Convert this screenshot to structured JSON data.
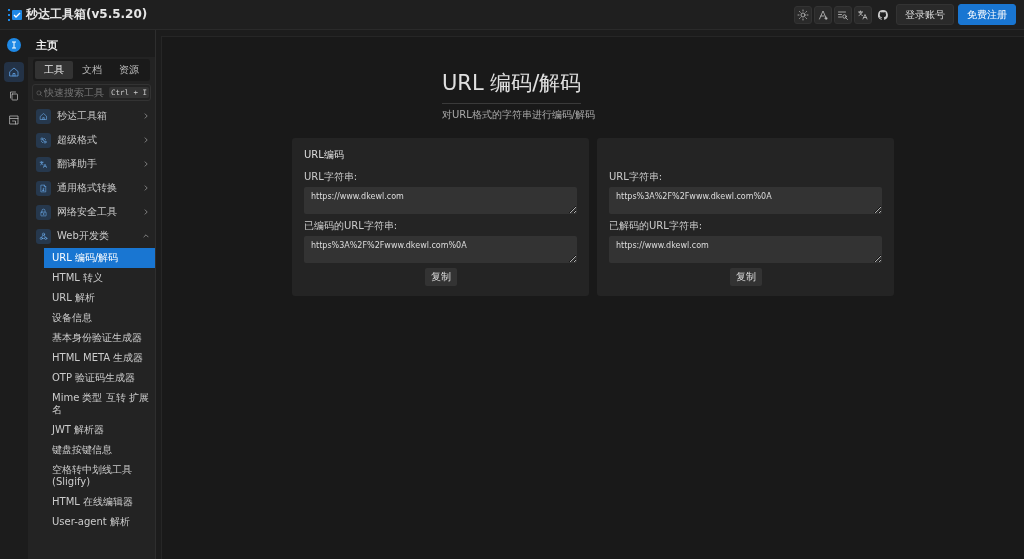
{
  "app": {
    "title": "秒达工具箱(v5.5.20)"
  },
  "toolbar": {
    "buttons": [
      {
        "label": "登录账号",
        "kind": "secondary"
      },
      {
        "label": "免费注册",
        "kind": "primary"
      }
    ]
  },
  "rail": {
    "items": [
      {
        "selected": true
      },
      {
        "selected": false
      },
      {
        "selected": false
      }
    ]
  },
  "sidebar": {
    "heading": "主页",
    "tabs": [
      {
        "label": "工具",
        "selected": true
      },
      {
        "label": "文档",
        "selected": false
      },
      {
        "label": "资源",
        "selected": false
      }
    ],
    "search": {
      "placeholder": "快速搜索工具",
      "shortcut": "Ctrl + I"
    },
    "items": [
      {
        "label": "秒达工具箱",
        "expanded": false
      },
      {
        "label": "超级格式",
        "expanded": false
      },
      {
        "label": "翻译助手",
        "expanded": false
      },
      {
        "label": "通用格式转换",
        "expanded": false
      },
      {
        "label": "网络安全工具",
        "expanded": false
      },
      {
        "label": "Web开发类",
        "expanded": true,
        "children": [
          {
            "label": "URL 编码/解码",
            "selected": true
          },
          {
            "label": "HTML 转义",
            "selected": false
          },
          {
            "label": "URL 解析",
            "selected": false
          },
          {
            "label": "设备信息",
            "selected": false
          },
          {
            "label": "基本身份验证生成器",
            "selected": false
          },
          {
            "label": "HTML META 生成器",
            "selected": false
          },
          {
            "label": "OTP 验证码生成器",
            "selected": false
          },
          {
            "label": "Mime 类型 互转 扩展名",
            "selected": false
          },
          {
            "label": "JWT 解析器",
            "selected": false
          },
          {
            "label": "键盘按键信息",
            "selected": false
          },
          {
            "label": "空格转中划线工具 (Sligify)",
            "selected": false
          },
          {
            "label": "HTML 在线编辑器",
            "selected": false
          },
          {
            "label": "User-agent 解析",
            "selected": false
          }
        ]
      }
    ]
  },
  "page": {
    "title": "URL 编码/解码",
    "subtitle": "对URL格式的字符串进行编码/解码",
    "cards": [
      {
        "title": "URL编码",
        "fields": [
          {
            "label": "URL字符串:",
            "value": "https://www.dkewl.com"
          },
          {
            "label": "已编码的URL字符串:",
            "value": "https%3A%2F%2Fwww.dkewl.com%0A"
          }
        ],
        "button": "复制"
      },
      {
        "fields": [
          {
            "label": "URL字符串:",
            "value": "https%3A%2F%2Fwww.dkewl.com%0A"
          },
          {
            "label": "已解码的URL字符串:",
            "value": "https://www.dkewl.com"
          }
        ],
        "button": "复制"
      }
    ]
  }
}
